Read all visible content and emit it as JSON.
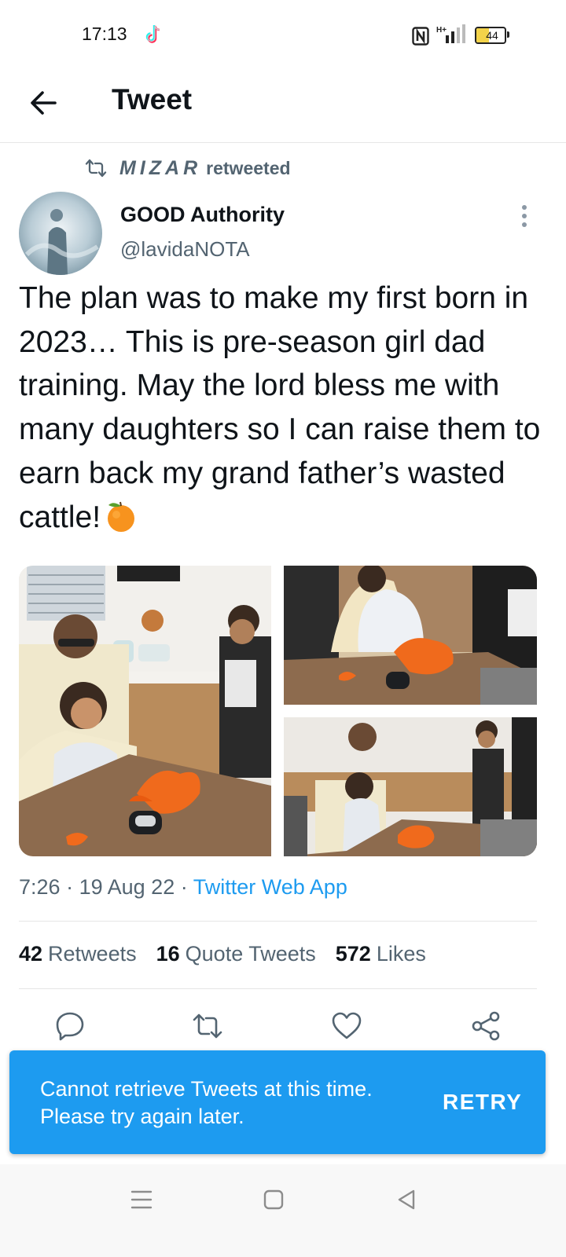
{
  "status_bar": {
    "time": "17:13",
    "notification_icon": "tiktok-icon",
    "nfc_icon": "nfc-icon",
    "signal_icon": "signal-icon",
    "signal_label": "H+",
    "battery_level": "44",
    "battery_fraction": 0.44,
    "battery_color": "#f3d34a"
  },
  "header": {
    "back_icon": "arrow-left-icon",
    "title": "Tweet"
  },
  "tweet": {
    "retweeted_by": "MIZAR",
    "retweeted_label": "retweeted",
    "author": {
      "name": "GOOD Authority",
      "handle": "@lavidaNOTA"
    },
    "text": "The plan was to make my first born in 2023… This is pre-season girl dad training. May the lord bless me with many daughters so I can raise them to earn back my grand father’s wasted cattle!",
    "emoji": "tangerine-emoji",
    "time": "7:26",
    "separator": "·",
    "date": "19 Aug 22",
    "source": "Twitter Web App",
    "stats": {
      "retweets_count": "42",
      "retweets_label": "Retweets",
      "quotes_count": "16",
      "quotes_label": "Quote Tweets",
      "likes_count": "572",
      "likes_label": "Likes"
    },
    "actions": [
      "reply-icon",
      "retweet-icon",
      "like-icon",
      "share-icon"
    ]
  },
  "snackbar": {
    "message": "Cannot retrieve Tweets at this time. Please try again later.",
    "action": "RETRY"
  },
  "nav_bar": [
    "menu-icon",
    "home-icon",
    "back-icon"
  ],
  "colors": {
    "accent": "#1d9bf0",
    "text_primary": "#0f1419",
    "text_secondary": "#536471",
    "divider": "#e6e6e6"
  }
}
